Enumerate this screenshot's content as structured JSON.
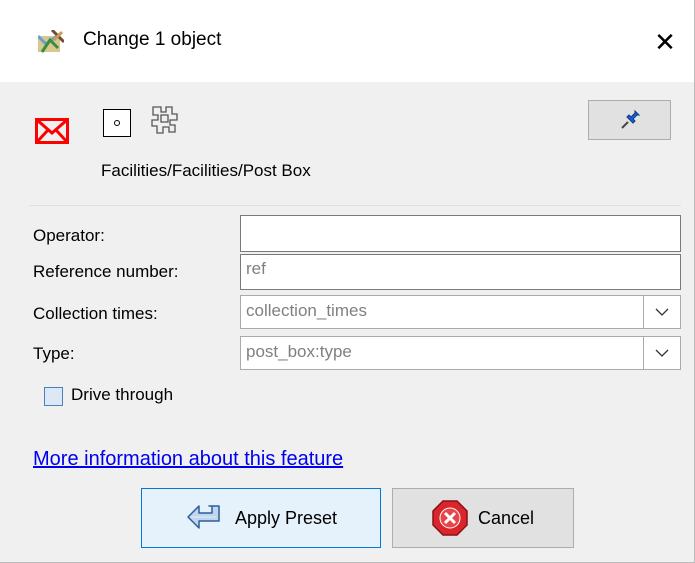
{
  "window": {
    "title": "Change 1 object",
    "close_glyph": "✕"
  },
  "preset": {
    "icons": [
      "post-box-envelope-icon",
      "node-icon",
      "multipolygon-icon"
    ],
    "path": "Facilities/Facilities/Post Box",
    "pin_icon": "pushpin-icon"
  },
  "form": {
    "fields": [
      {
        "label": "Operator:",
        "value": ""
      },
      {
        "label": "Reference number:",
        "placeholder": "ref"
      },
      {
        "label": "Collection times:",
        "placeholder": "collection_times"
      },
      {
        "label": "Type:",
        "placeholder": "post_box:type"
      }
    ],
    "checkbox": {
      "label": "Drive through",
      "checked": false
    }
  },
  "more_info_link": "More information about this feature",
  "buttons": {
    "apply": "Apply Preset",
    "cancel": "Cancel"
  },
  "colors": {
    "accent": "#0078d7",
    "link": "#0000ee",
    "envelope": "#ff0000",
    "cancel_icon": "#d9262c"
  }
}
